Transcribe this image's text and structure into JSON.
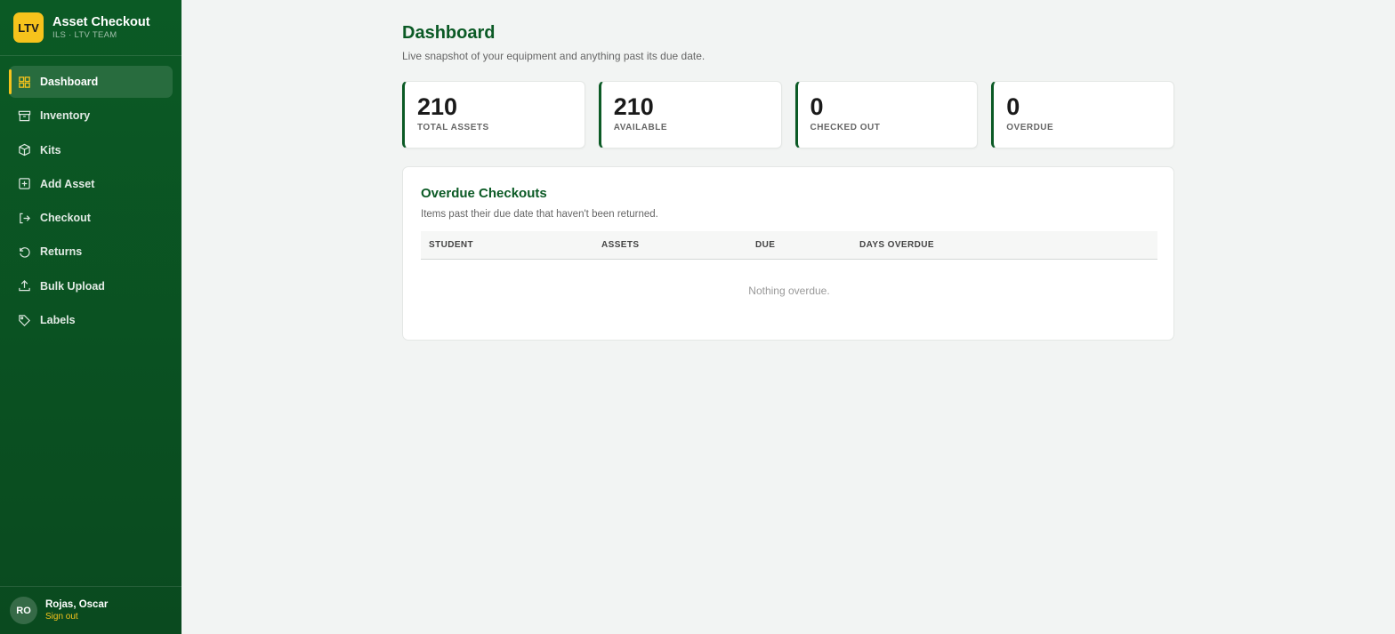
{
  "brand": {
    "logo": "LTV",
    "title": "Asset Checkout",
    "subtitle": "ILS · LTV TEAM"
  },
  "nav": [
    {
      "label": "Dashboard",
      "icon": "grid-icon",
      "active": true
    },
    {
      "label": "Inventory",
      "icon": "archive-icon",
      "active": false
    },
    {
      "label": "Kits",
      "icon": "box-icon",
      "active": false
    },
    {
      "label": "Add Asset",
      "icon": "plus-square-icon",
      "active": false
    },
    {
      "label": "Checkout",
      "icon": "log-out-icon",
      "active": false
    },
    {
      "label": "Returns",
      "icon": "rotate-ccw-icon",
      "active": false
    },
    {
      "label": "Bulk Upload",
      "icon": "upload-icon",
      "active": false
    },
    {
      "label": "Labels",
      "icon": "tag-icon",
      "active": false
    }
  ],
  "user": {
    "initials": "RO",
    "name": "Rojas, Oscar",
    "sign_out": "Sign out"
  },
  "page": {
    "title": "Dashboard",
    "subtitle": "Live snapshot of your equipment and anything past its due date."
  },
  "stats": [
    {
      "value": "210",
      "label": "TOTAL ASSETS"
    },
    {
      "value": "210",
      "label": "AVAILABLE"
    },
    {
      "value": "0",
      "label": "CHECKED OUT"
    },
    {
      "value": "0",
      "label": "OVERDUE"
    }
  ],
  "overdue": {
    "title": "Overdue Checkouts",
    "subtitle": "Items past their due date that haven't been returned.",
    "columns": [
      "STUDENT",
      "ASSETS",
      "DUE",
      "DAYS OVERDUE"
    ],
    "empty_message": "Nothing overdue."
  },
  "colors": {
    "brand_green": "#0b5a25",
    "accent_yellow": "#f6c31c",
    "background": "#f2f4f3"
  }
}
